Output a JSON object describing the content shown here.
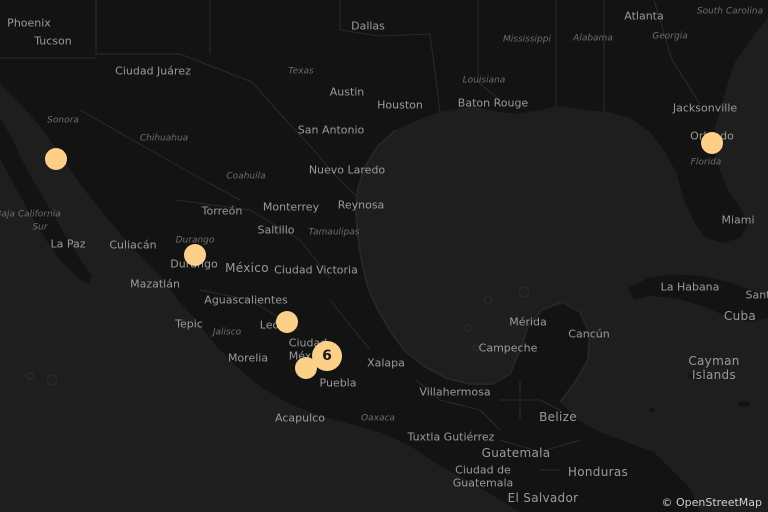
{
  "attribution": {
    "symbol": "©",
    "link_text": "OpenStreetMap"
  },
  "colors": {
    "water": "#1e1e1e",
    "land": "#121212",
    "border": "#2a2a2a",
    "marker": "#fdd08a"
  },
  "labels": {
    "phoenix": "Phoenix",
    "tucson": "Tucson",
    "dallas": "Dallas",
    "atlanta": "Atlanta",
    "south_carolina": "South Carolina",
    "mississippi": "Mississippi",
    "alabama": "Alabama",
    "georgia": "Georgia",
    "ciudad_juarez": "Ciudad Juárez",
    "texas": "Texas",
    "louisiana": "Louisiana",
    "austin": "Austin",
    "houston": "Houston",
    "baton_rouge": "Baton Rouge",
    "jacksonville": "Jacksonville",
    "sonora": "Sonora",
    "san_antonio": "San Antonio",
    "chihuahua": "Chihuahua",
    "orlando": "Orlando",
    "nuevo_laredo": "Nuevo Laredo",
    "florida": "Florida",
    "coahuila": "Coahuila",
    "torreon": "Torreón",
    "monterrey": "Monterrey",
    "reynosa": "Reynosa",
    "baja_california_sur_1": "Baja California",
    "baja_california_sur_2": "Sur",
    "miami": "Miami",
    "saltillo": "Saltillo",
    "tamaulipas": "Tamaulipas",
    "la_paz": "La Paz",
    "culiacan": "Culiacán",
    "durango_state": "Durango",
    "durango_city": "Durango",
    "mexico": "México",
    "ciudad_victoria": "Ciudad Victoria",
    "mazatlan": "Mazatlán",
    "la_habana": "La Habana",
    "santa": "Sant",
    "aguascalientes": "Aguascalientes",
    "cuba": "Cuba",
    "tepic": "Tepic",
    "jalisco": "Jalisco",
    "leon": "León",
    "merida": "Mérida",
    "cancun": "Cancún",
    "ciudad_mx": "Ciudad",
    "mexico_city_part": "México",
    "campeche": "Campeche",
    "morelia": "Morelia",
    "xalapa": "Xalapa",
    "cayman_1": "Cayman",
    "cayman_2": "Islands",
    "puebla": "Puebla",
    "villahermosa": "Villahermosa",
    "belize": "Belize",
    "acapulco": "Acapulco",
    "oaxaca": "Oaxaca",
    "tuxtla": "Tuxtla Gutiérrez",
    "guatemala": "Guatemala",
    "honduras": "Honduras",
    "ciudad_guatemala_1": "Ciudad de",
    "ciudad_guatemala_2": "Guatemala",
    "el_salvador": "El Salvador"
  },
  "markers": [
    {
      "id": "sonora-marker",
      "count": "",
      "cluster": false
    },
    {
      "id": "durango-marker",
      "count": "",
      "cluster": false
    },
    {
      "id": "leon-marker",
      "count": "",
      "cluster": false
    },
    {
      "id": "mexico-city-cluster",
      "count": "6",
      "cluster": true
    },
    {
      "id": "morelos-marker",
      "count": "",
      "cluster": false
    },
    {
      "id": "orlando-marker",
      "count": "",
      "cluster": false
    }
  ]
}
